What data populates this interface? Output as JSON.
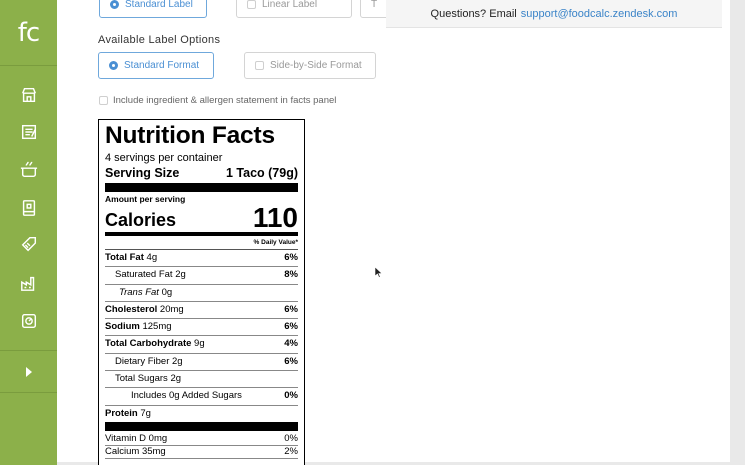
{
  "sidebar": {
    "logo": "fc",
    "items": [
      {
        "icon": "store-icon"
      },
      {
        "icon": "recipe-icon"
      },
      {
        "icon": "pot-icon"
      },
      {
        "icon": "book-icon"
      },
      {
        "icon": "tag-icon"
      },
      {
        "icon": "factory-icon"
      },
      {
        "icon": "gauge-icon"
      }
    ],
    "expand_icon": "chevron-right-icon",
    "color": "#8cb04a"
  },
  "label_types": {
    "standard": "Standard Label",
    "linear": "Linear Label",
    "third_partial": "T"
  },
  "label_options": {
    "title": "Available Label Options",
    "standard_format": "Standard Format",
    "side_by_side": "Side-by-Side Format",
    "include_statement": "Include ingredient & allergen statement in facts panel"
  },
  "questions": {
    "text": "Questions? Email",
    "email": "support@foodcalc.zendesk.com"
  },
  "nutrition": {
    "title": "Nutrition Facts",
    "servings": "4 servings per container",
    "serving_size_label": "Serving Size",
    "serving_size_value": "1 Taco (79g)",
    "amount_per_serving": "Amount per serving",
    "calories_label": "Calories",
    "calories_value": "110",
    "dv_header": "% Daily Value*",
    "rows": [
      {
        "label": "Total Fat",
        "amount": "4g",
        "pct": "6%"
      },
      {
        "label": "Saturated Fat",
        "amount": "2g",
        "pct": "8%"
      },
      {
        "label": "Trans Fat",
        "amount": "0g",
        "pct": ""
      },
      {
        "label": "Cholesterol",
        "amount": "20mg",
        "pct": "6%"
      },
      {
        "label": "Sodium",
        "amount": "125mg",
        "pct": "6%"
      },
      {
        "label": "Total Carbohydrate",
        "amount": "9g",
        "pct": "4%"
      },
      {
        "label": "Dietary Fiber",
        "amount": "2g",
        "pct": "6%"
      },
      {
        "label": "Total Sugars",
        "amount": "2g",
        "pct": ""
      },
      {
        "label": "Includes 0g Added Sugars",
        "amount": "",
        "pct": "0%"
      },
      {
        "label": "Protein",
        "amount": "7g",
        "pct": ""
      }
    ],
    "vitamins": [
      {
        "label": "Vitamin D",
        "amount": "0mg",
        "pct": "0%"
      },
      {
        "label": "Calcium",
        "amount": "35mg",
        "pct": "2%"
      }
    ]
  }
}
